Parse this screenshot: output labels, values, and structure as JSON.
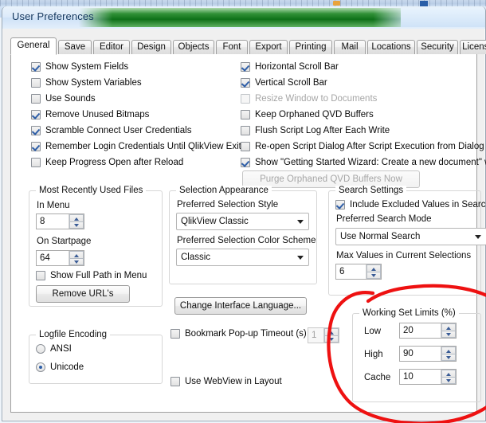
{
  "window": {
    "title": "User Preferences"
  },
  "tabs": [
    {
      "label": "General",
      "active": true
    },
    {
      "label": "Save",
      "active": false
    },
    {
      "label": "Editor",
      "active": false
    },
    {
      "label": "Design",
      "active": false
    },
    {
      "label": "Objects",
      "active": false
    },
    {
      "label": "Font",
      "active": false
    },
    {
      "label": "Export",
      "active": false
    },
    {
      "label": "Printing",
      "active": false
    },
    {
      "label": "Mail",
      "active": false
    },
    {
      "label": "Locations",
      "active": false
    },
    {
      "label": "Security",
      "active": false
    },
    {
      "label": "License",
      "active": false
    }
  ],
  "left_checkboxes": [
    {
      "label": "Show System Fields",
      "checked": true
    },
    {
      "label": "Show System Variables",
      "checked": false
    },
    {
      "label": "Use Sounds",
      "checked": false
    },
    {
      "label": "Remove Unused Bitmaps",
      "checked": true
    },
    {
      "label": "Scramble Connect User Credentials",
      "checked": true
    },
    {
      "label": "Remember Login Credentials Until QlikView Exits",
      "checked": true
    },
    {
      "label": "Keep Progress Open after Reload",
      "checked": false
    }
  ],
  "right_checkboxes": [
    {
      "label": "Horizontal Scroll Bar",
      "checked": true,
      "disabled": false
    },
    {
      "label": "Vertical Scroll Bar",
      "checked": true,
      "disabled": false
    },
    {
      "label": "Resize Window to Documents",
      "checked": false,
      "disabled": true
    },
    {
      "label": "Keep Orphaned QVD Buffers",
      "checked": false,
      "disabled": false
    },
    {
      "label": "Flush Script Log After Each Write",
      "checked": false,
      "disabled": false
    },
    {
      "label": "Re-open Script Dialog After Script Execution from Dialog",
      "checked": false,
      "disabled": false
    },
    {
      "label": "Show \"Getting Started Wizard: Create a new document\" wh",
      "checked": true,
      "disabled": false
    }
  ],
  "purge_button": {
    "label": "Purge Orphaned QVD Buffers Now",
    "disabled": true
  },
  "mru": {
    "caption": "Most Recently Used Files",
    "in_menu_label": "In Menu",
    "in_menu_value": "8",
    "on_startpage_label": "On Startpage",
    "on_startpage_value": "64",
    "show_full_path_label": "Show Full Path in Menu",
    "show_full_path_checked": false,
    "remove_urls_label": "Remove URL's"
  },
  "logfile": {
    "caption": "Logfile Encoding",
    "options": [
      {
        "label": "ANSI",
        "selected": false
      },
      {
        "label": "Unicode",
        "selected": true
      }
    ]
  },
  "selection": {
    "caption": "Selection Appearance",
    "style_label": "Preferred Selection Style",
    "style_value": "QlikView Classic",
    "scheme_label": "Preferred Selection Color Scheme",
    "scheme_value": "Classic"
  },
  "change_language_button": {
    "label": "Change Interface Language..."
  },
  "bookmark_timeout": {
    "label": "Bookmark Pop-up Timeout (s)",
    "checked": false,
    "value": "1",
    "disabled": true
  },
  "webview": {
    "label": "Use WebView in Layout",
    "checked": false
  },
  "search": {
    "caption": "Search Settings",
    "include_excluded_label": "Include Excluded Values in Search",
    "include_excluded_checked": true,
    "mode_label": "Preferred Search Mode",
    "mode_value": "Use Normal Search",
    "max_values_label": "Max Values in Current Selections",
    "max_values": "6"
  },
  "working_set": {
    "caption": "Working Set Limits (%)",
    "rows": [
      {
        "label": "Low",
        "value": "20"
      },
      {
        "label": "High",
        "value": "90"
      },
      {
        "label": "Cache",
        "value": "10"
      }
    ]
  },
  "annotation": {
    "shape": "red-ellipse-highlight",
    "color": "#ee1111"
  }
}
